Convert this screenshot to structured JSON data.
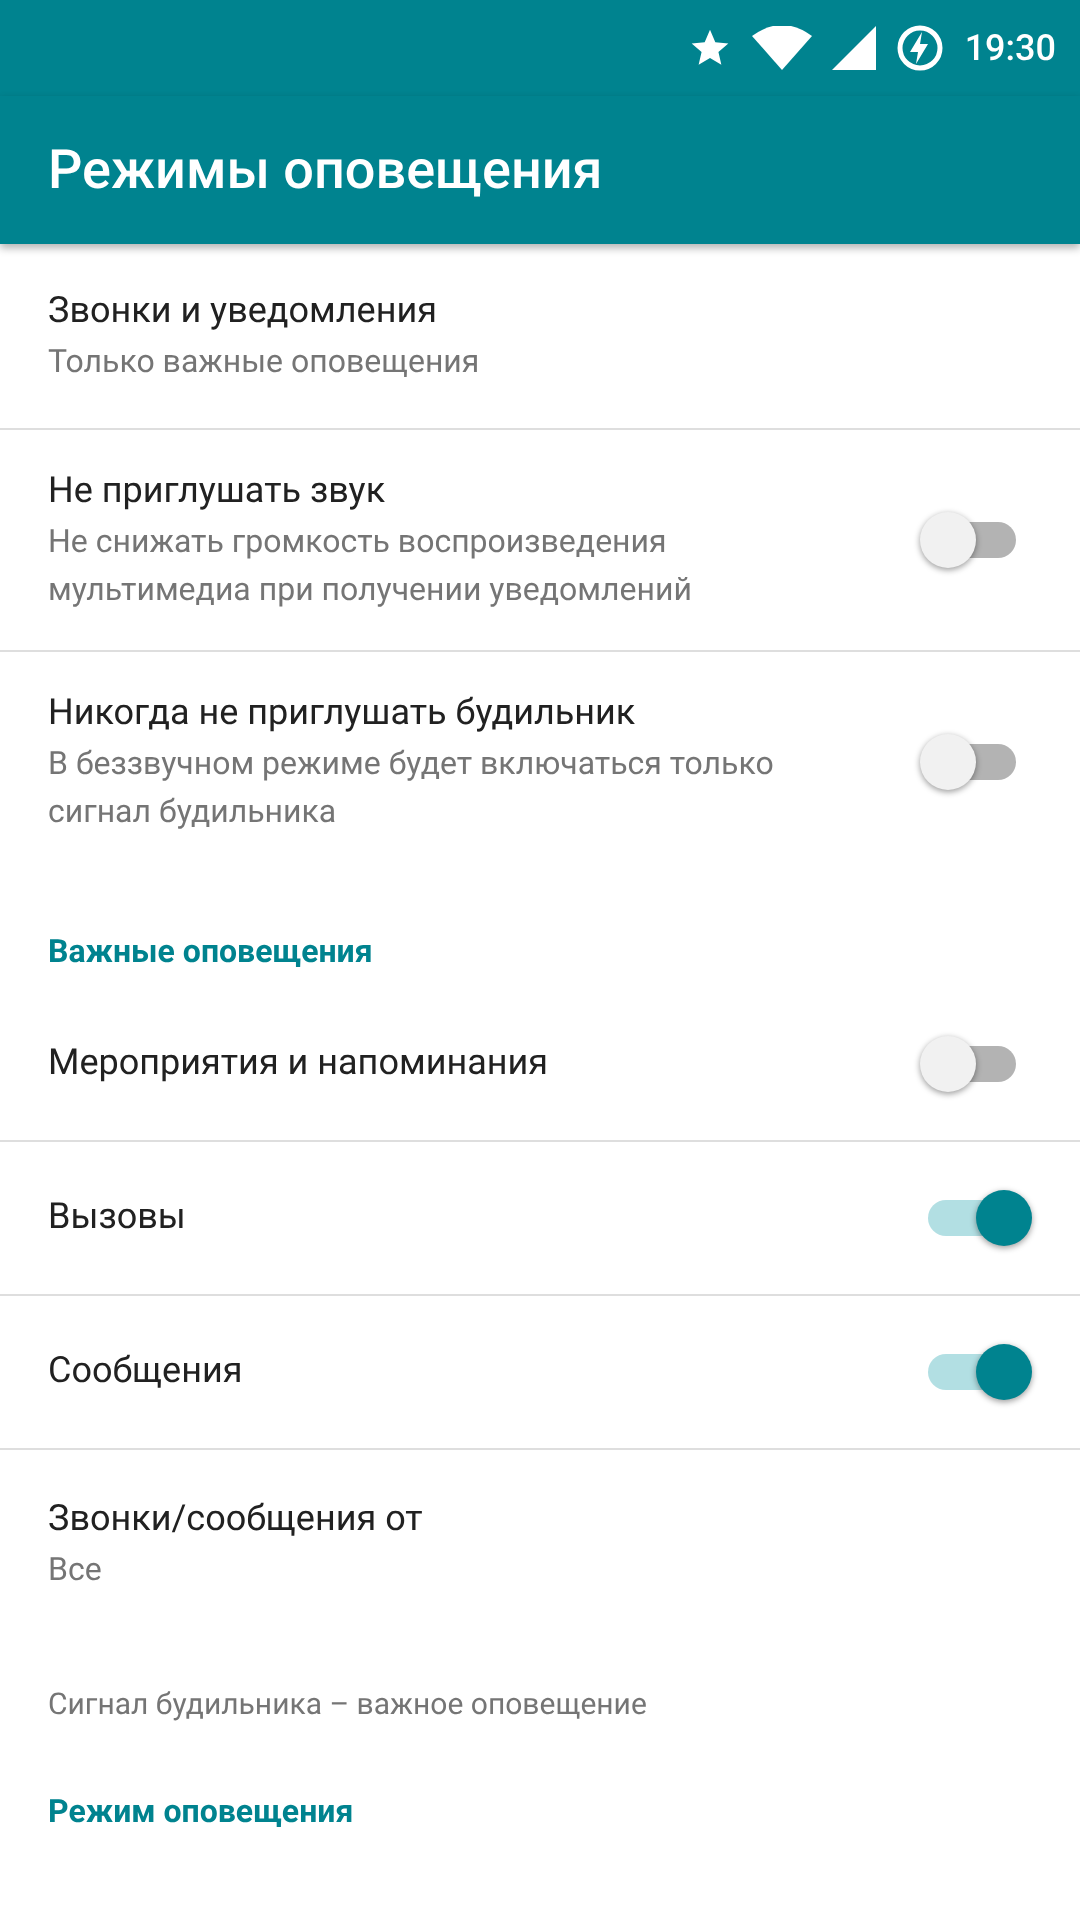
{
  "status_bar": {
    "time": "19:30"
  },
  "app_bar": {
    "title": "Режимы оповещения"
  },
  "rows": [
    {
      "kind": "item",
      "title": "Звонки и уведомления",
      "subtitle": "Только важные оповещения",
      "divider": true
    },
    {
      "kind": "switch",
      "title": "Не приглушать звук",
      "subtitle": "Не снижать громкость воспроизведения мультимедиа при получении уведомлений",
      "on": false,
      "divider": true
    },
    {
      "kind": "switch",
      "title": "Никогда не приглушать будильник",
      "subtitle": "В беззвучном режиме будет включаться только сигнал будильника",
      "on": false,
      "divider": false
    },
    {
      "kind": "header",
      "title": "Важные оповещения"
    },
    {
      "kind": "switch",
      "title": "Мероприятия и напоминания",
      "on": false,
      "divider": true
    },
    {
      "kind": "switch",
      "title": "Вызовы",
      "on": true,
      "divider": true
    },
    {
      "kind": "switch",
      "title": "Сообщения",
      "on": true,
      "divider": true
    },
    {
      "kind": "item",
      "title": "Звонки/сообщения от",
      "subtitle": "Все",
      "divider": false
    },
    {
      "kind": "note",
      "title": "Сигнал будильника – важное оповещение"
    },
    {
      "kind": "header",
      "title": "Режим оповещения"
    }
  ]
}
